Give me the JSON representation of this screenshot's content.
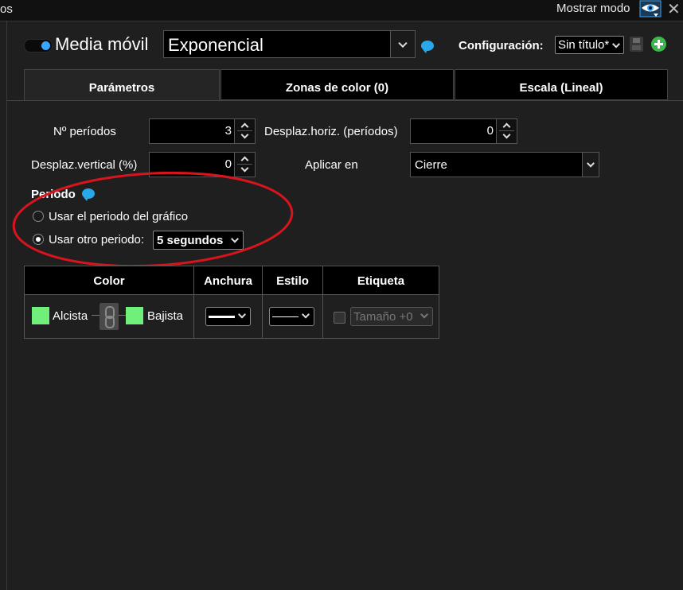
{
  "top_bar": {
    "left_text": "os",
    "mostrar_label": "Mostrar modo"
  },
  "indicator": {
    "enabled": true,
    "name": "Media móvil",
    "type_value": "Exponencial"
  },
  "config": {
    "label": "Configuración:",
    "value": "Sin título*"
  },
  "tabs": [
    {
      "label": "Parámetros",
      "active": true
    },
    {
      "label": "Zonas de color (0)",
      "active": false
    },
    {
      "label": "Escala (Lineal)",
      "active": false
    }
  ],
  "form": {
    "periods_label": "Nº períodos",
    "periods_value": "3",
    "hshift_label": "Desplaz.horiz. (períodos)",
    "hshift_value": "0",
    "vshift_label": "Desplaz.vertical (%)",
    "vshift_value": "0",
    "apply_label": "Aplicar en",
    "apply_value": "Cierre"
  },
  "periodo": {
    "title": "Periodo",
    "option_chart": "Usar el periodo del gráfico",
    "option_other": "Usar otro periodo:",
    "selected": "other",
    "other_value": "5 segundos"
  },
  "style_table": {
    "headers": [
      "Color",
      "Anchura",
      "Estilo",
      "Etiqueta"
    ],
    "bull_label": "Alcista",
    "bear_label": "Bajista",
    "bull_color": "#6ef07a",
    "bear_color": "#6ef07a",
    "label_checked": false,
    "label_size_value": "Tamaño +0"
  },
  "colors": {
    "accent": "#39a7ff",
    "highlight_ellipse": "#d9141c",
    "add": "#3bb84a"
  }
}
